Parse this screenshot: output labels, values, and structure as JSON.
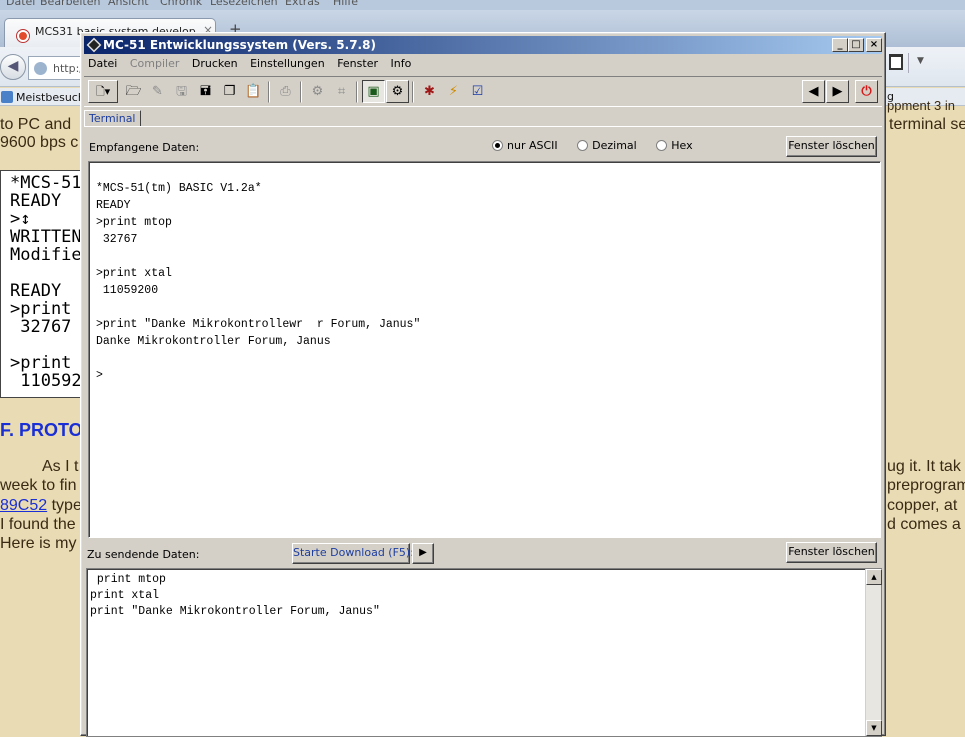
{
  "browser": {
    "menu": [
      "Datei",
      "Bearbeiten",
      "Ansicht",
      "Chronik",
      "Lesezeichen",
      "Extras",
      "Hilfe"
    ],
    "tab_title": "MCS31 basic system develop",
    "tab_close": "×",
    "new_tab": "+",
    "back_glyph": "◀",
    "url_text": "http:/",
    "bookmarks_label": "Meistbesucht",
    "bookmarks_right": "g",
    "page_fragments": {
      "line1_left": "to PC and",
      "line1_right": "terminal se",
      "line2_left": "9600 bps c",
      "basic_box": "*MCS-51\nREADY\n>↕\nWRITTEN\nModifie\n\nREADY\n>print\n 32767\n\n>print\n 110592",
      "heading": "F. PROTO",
      "para_l1": "As I t",
      "para_r1": "ug it. It tak",
      "para_l2": "week to fin",
      "para_r2": "preprogram",
      "para_link": "89C52",
      "para_l3_rest": " type",
      "para_r3": "copper, at",
      "para_l4": "I found the",
      "para_r4": "d comes a",
      "para_l5": "Here is my",
      "top_right": "ppment 3 in"
    }
  },
  "window": {
    "title": "MC-51 Entwicklungssystem (Vers. 5.7.8)",
    "min_glyph": "_",
    "max_glyph": "□",
    "close_glyph": "×"
  },
  "menu": [
    {
      "label": "Datei",
      "enabled": true
    },
    {
      "label": "Compiler",
      "enabled": false
    },
    {
      "label": "Drucken",
      "enabled": true
    },
    {
      "label": "Einstellungen",
      "enabled": true
    },
    {
      "label": "Fenster",
      "enabled": true
    },
    {
      "label": "Info",
      "enabled": true
    }
  ],
  "toolbar_glyphs": {
    "new": "🗋▾",
    "open": "🗁",
    "edit": "✎",
    "save": "🖫",
    "save_all": "🖬",
    "copy": "❐",
    "paste": "📋",
    "print": "⎙",
    "compile": "⚙",
    "assemble": "⌗",
    "terminal": "▣",
    "settings": "⚙",
    "debug": "✱",
    "flash": "⚡",
    "verify": "☑",
    "prev": "◀",
    "next": "▶",
    "power": "⏻"
  },
  "tab_label": "Terminal",
  "receive": {
    "label": "Empfangene Daten:",
    "radios": [
      {
        "label": "nur ASCII",
        "checked": true
      },
      {
        "label": "Dezimal",
        "checked": false
      },
      {
        "label": "Hex",
        "checked": false
      }
    ],
    "clear_label": "Fenster löschen",
    "content": "*MCS-51(tm) BASIC V1.2a*\nREADY\n>print mtop\n 32767\n\n>print xtal\n 11059200\n\n>print \"Danke Mikrokontrollewr  r Forum, Janus\"\nDanke Mikrokontroller Forum, Janus\n\n>"
  },
  "send": {
    "label": "Zu sendende Daten:",
    "download_label": "Starte Download (F5):",
    "play_glyph": "▶",
    "clear_label": "Fenster löschen",
    "content": " print mtop\nprint xtal\nprint \"Danke Mikrokontroller Forum, Janus\"",
    "scroll_up": "▲",
    "scroll_down": "▼"
  }
}
